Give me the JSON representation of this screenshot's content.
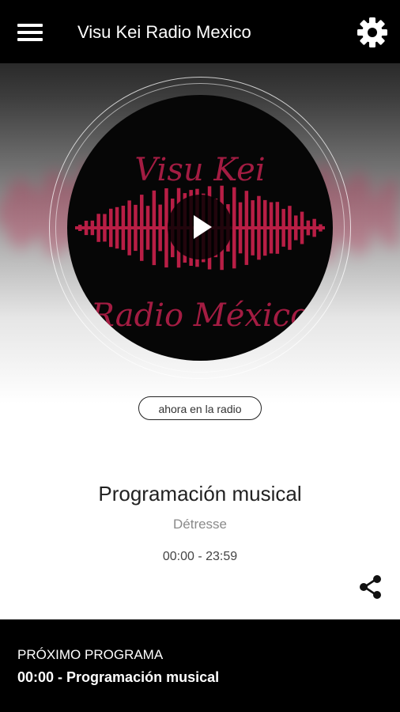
{
  "app_title": "Visu Kei Radio Mexico",
  "icons": {
    "menu": "hamburger-menu-icon",
    "settings": "gear-icon",
    "play": "play-icon",
    "share": "share-icon"
  },
  "logo": {
    "line1": "Visu Kei",
    "line2": "Radio México"
  },
  "live_label": "ahora en la radio",
  "now_playing": {
    "program": "Programación musical",
    "artist": "Détresse",
    "schedule": "00:00 - 23:59"
  },
  "next": {
    "label": "PRÓXIMO PROGRAMA",
    "program": "00:00 - Programación musical"
  },
  "colors": {
    "bar": "#000000",
    "accent": "#b81e45",
    "background": "#ffffff"
  }
}
